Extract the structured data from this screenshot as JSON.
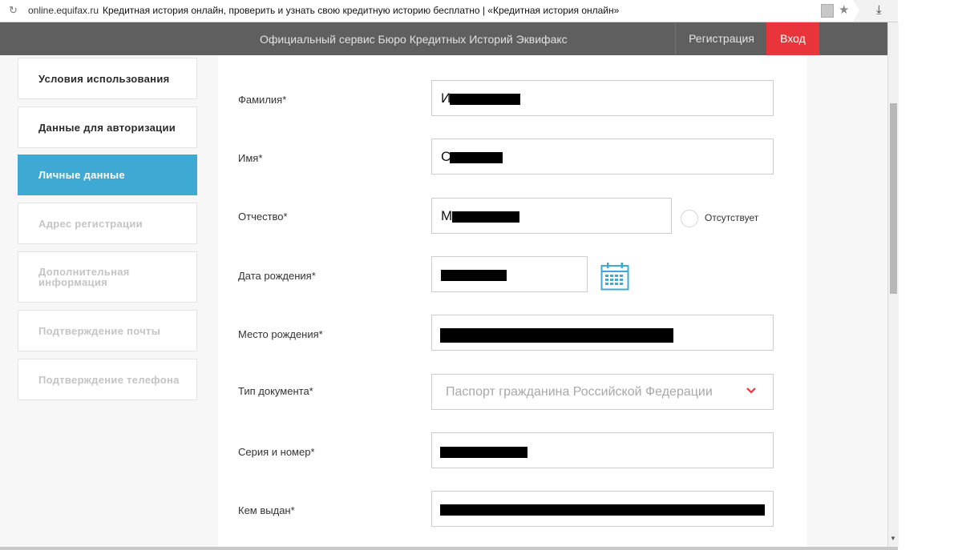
{
  "browser": {
    "url": "online.equifax.ru",
    "page_title": "Кредитная история онлайн, проверить и узнать свою кредитную историю бесплатно | «Кредитная история онлайн»"
  },
  "header": {
    "title": "Официальный сервис Бюро Кредитных Историй Эквифакс",
    "register_label": "Регистрация",
    "login_label": "Вход",
    "login_color": "#e8343a",
    "bg_color": "#5f5f5f"
  },
  "steps": [
    {
      "label": "Условия использования",
      "state": "done"
    },
    {
      "label": "Данные для авторизации",
      "state": "done"
    },
    {
      "label": "Личные данные",
      "state": "active"
    },
    {
      "label": "Адрес регистрации",
      "state": "pending"
    },
    {
      "label": "Дополнительная информация",
      "state": "pending"
    },
    {
      "label": "Подтверждение почты",
      "state": "pending"
    },
    {
      "label": "Подтверждение телефона",
      "state": "pending"
    }
  ],
  "active_step_color": "#3ea9d3",
  "form": {
    "surname": {
      "label": "Фамилия*",
      "value_prefix": "И"
    },
    "name": {
      "label": "Имя*",
      "value_prefix": "С"
    },
    "patronymic": {
      "label": "Отчество*",
      "value_prefix": "М",
      "absent_label": "Отсутствует"
    },
    "birth_date": {
      "label": "Дата рождения*"
    },
    "birth_place": {
      "label": "Место рождения*"
    },
    "doc_type": {
      "label": "Тип документа*",
      "selected": "Паспорт гражданина Российской Федерации"
    },
    "series_number": {
      "label": "Серия и номер*"
    },
    "issued_by": {
      "label": "Кем выдан*"
    }
  }
}
